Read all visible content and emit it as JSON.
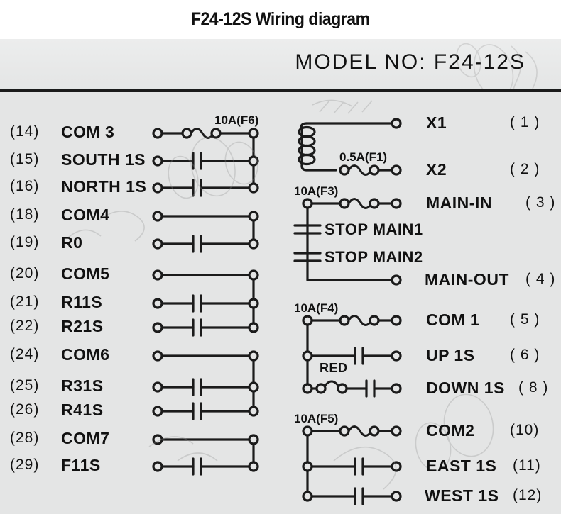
{
  "header": {
    "title": "F24-12S Wiring diagram",
    "model_label": "MODEL NO: F24-12S"
  },
  "left_column": {
    "groups": [
      {
        "fuse_label": "10A(F6)",
        "rows": [
          {
            "pin": "(14)",
            "name": "COM 3",
            "symbol": "fuse"
          },
          {
            "pin": "(15)",
            "name": "SOUTH 1S",
            "symbol": "contact"
          },
          {
            "pin": "(16)",
            "name": "NORTH 1S",
            "symbol": "contact"
          }
        ]
      },
      {
        "fuse_label": "",
        "rows": [
          {
            "pin": "(18)",
            "name": "COM4",
            "symbol": "wire"
          },
          {
            "pin": "(19)",
            "name": "R0",
            "symbol": "contact"
          }
        ]
      },
      {
        "fuse_label": "",
        "rows": [
          {
            "pin": "(20)",
            "name": "COM5",
            "symbol": "wire"
          },
          {
            "pin": "(21)",
            "name": "R11S",
            "symbol": "contact"
          },
          {
            "pin": "(22)",
            "name": "R21S",
            "symbol": "contact"
          }
        ]
      },
      {
        "fuse_label": "",
        "rows": [
          {
            "pin": "(24)",
            "name": "COM6",
            "symbol": "wire"
          },
          {
            "pin": "(25)",
            "name": "R31S",
            "symbol": "contact"
          },
          {
            "pin": "(26)",
            "name": "R41S",
            "symbol": "contact"
          }
        ]
      },
      {
        "fuse_label": "",
        "rows": [
          {
            "pin": "(28)",
            "name": "COM7",
            "symbol": "wire"
          },
          {
            "pin": "(29)",
            "name": "F11S",
            "symbol": "contact"
          }
        ]
      }
    ]
  },
  "right_column": {
    "groups": [
      {
        "fuse_label": "0.5A(F1)",
        "has_transformer": true,
        "rows": [
          {
            "name": "X1",
            "pin": "( 1 )",
            "symbol": "wire"
          },
          {
            "name": "X2",
            "pin": "( 2 )",
            "symbol": "fuse"
          }
        ]
      },
      {
        "fuse_label": "10A(F3)",
        "rows": [
          {
            "name": "MAIN-IN",
            "pin": "( 3 )",
            "symbol": "fuse"
          },
          {
            "name": "STOP MAIN1",
            "pin": "",
            "symbol": "stop-contact"
          },
          {
            "name": "STOP MAIN2",
            "pin": "",
            "symbol": "stop-contact"
          },
          {
            "name": "MAIN-OUT",
            "pin": "( 4 )",
            "symbol": "wire"
          }
        ]
      },
      {
        "fuse_label": "10A(F4)",
        "extra_label": "RED",
        "rows": [
          {
            "name": "COM 1",
            "pin": "( 5 )",
            "symbol": "fuse"
          },
          {
            "name": "UP 1S",
            "pin": "( 6 )",
            "symbol": "contact"
          },
          {
            "name": "DOWN 1S",
            "pin": "( 8 )",
            "symbol": "red-fuse-contact"
          }
        ]
      },
      {
        "fuse_label": "10A(F5)",
        "rows": [
          {
            "name": "COM2",
            "pin": "(10)",
            "symbol": "fuse"
          },
          {
            "name": "EAST 1S",
            "pin": "(11)",
            "symbol": "contact"
          },
          {
            "name": "WEST 1S",
            "pin": "(12)",
            "symbol": "contact"
          }
        ]
      }
    ]
  },
  "colors": {
    "line": "#1b1b1b",
    "panel_bg": "#e4e5e5",
    "header_bg": "#ffffff",
    "text": "#111111"
  }
}
